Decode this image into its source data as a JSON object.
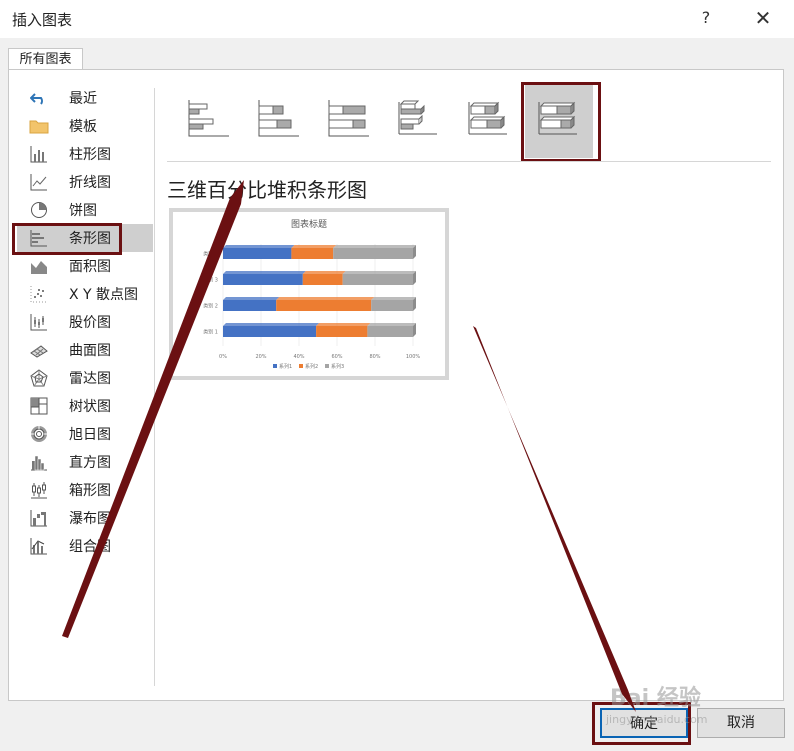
{
  "window": {
    "title": "插入图表",
    "help": "?",
    "close": "✕"
  },
  "tabs": [
    {
      "label": "所有图表"
    }
  ],
  "categories": [
    {
      "label": "最近",
      "icon": "undo-icon"
    },
    {
      "label": "模板",
      "icon": "folder-icon"
    },
    {
      "label": "柱形图",
      "icon": "column-chart-icon"
    },
    {
      "label": "折线图",
      "icon": "line-chart-icon"
    },
    {
      "label": "饼图",
      "icon": "pie-chart-icon"
    },
    {
      "label": "条形图",
      "icon": "bar-chart-icon"
    },
    {
      "label": "面积图",
      "icon": "area-chart-icon"
    },
    {
      "label": "X Y 散点图",
      "icon": "scatter-chart-icon"
    },
    {
      "label": "股价图",
      "icon": "stock-chart-icon"
    },
    {
      "label": "曲面图",
      "icon": "surface-chart-icon"
    },
    {
      "label": "雷达图",
      "icon": "radar-chart-icon"
    },
    {
      "label": "树状图",
      "icon": "treemap-chart-icon"
    },
    {
      "label": "旭日图",
      "icon": "sunburst-chart-icon"
    },
    {
      "label": "直方图",
      "icon": "histogram-chart-icon"
    },
    {
      "label": "箱形图",
      "icon": "box-chart-icon"
    },
    {
      "label": "瀑布图",
      "icon": "waterfall-chart-icon"
    },
    {
      "label": "组合图",
      "icon": "combo-chart-icon"
    }
  ],
  "selected_category": "条形图",
  "subtypes": [
    "clustered-bar-icon",
    "stacked-bar-icon",
    "percent-stacked-bar-icon",
    "3d-clustered-bar-icon",
    "3d-stacked-bar-icon",
    "3d-percent-stacked-bar-icon"
  ],
  "selected_subtype_index": 5,
  "chart_type_title": "三维百分比堆积条形图",
  "preview": {
    "title": "图表标题",
    "categories": [
      "类别 4",
      "类别 3",
      "类别 2",
      "类别 1"
    ],
    "series": [
      {
        "name": "系列1",
        "color": "#4472c4",
        "values": [
          0.36,
          0.42,
          0.28,
          0.49
        ]
      },
      {
        "name": "系列2",
        "color": "#ed7d31",
        "values": [
          0.22,
          0.21,
          0.5,
          0.27
        ]
      },
      {
        "name": "系列3",
        "color": "#a5a5a5",
        "values": [
          0.42,
          0.37,
          0.22,
          0.24
        ]
      }
    ],
    "xticks": [
      "0%",
      "20%",
      "40%",
      "60%",
      "80%",
      "100%"
    ]
  },
  "buttons": {
    "ok": "确定",
    "cancel": "取消"
  },
  "watermark": {
    "main": "Bai 经验",
    "sub": "jingyan.baidu.com"
  },
  "colors": {
    "highlight": "#6b1012",
    "accent": "#0a64b4"
  }
}
